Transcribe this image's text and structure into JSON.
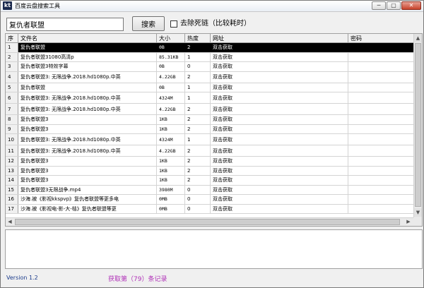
{
  "window": {
    "logo": "kt",
    "title": "百度云盘搜索工具",
    "controls": [
      "─",
      "▢",
      "✕"
    ]
  },
  "toolbar": {
    "search_value": "复仇者联盟",
    "search_button": "搜索",
    "dead_link_label": "去除死链（比较耗时）"
  },
  "table": {
    "columns": [
      "序",
      "文件名",
      "大小",
      "热度",
      "网址",
      "密码"
    ],
    "rows": [
      {
        "idx": "1",
        "name": "复仇者联盟",
        "size": "0B",
        "heat": "2",
        "url": "双击获取",
        "pwd": ""
      },
      {
        "idx": "2",
        "name": "复仇者联盟31080高清p",
        "size": "85.31KB",
        "heat": "1",
        "url": "双击获取",
        "pwd": ""
      },
      {
        "idx": "3",
        "name": "复仇者联盟3特效字幕",
        "size": "0B",
        "heat": "0",
        "url": "双击获取",
        "pwd": ""
      },
      {
        "idx": "4",
        "name": "复仇者联盟3: 无限战争.2018.hd1080p.中英",
        "size": "4.22GB",
        "heat": "2",
        "url": "双击获取",
        "pwd": ""
      },
      {
        "idx": "5",
        "name": "复仇者联盟",
        "size": "0B",
        "heat": "1",
        "url": "双击获取",
        "pwd": ""
      },
      {
        "idx": "6",
        "name": "复仇者联盟3: 无限战争.2018.hd1080p.中英",
        "size": "4324M",
        "heat": "1",
        "url": "双击获取",
        "pwd": ""
      },
      {
        "idx": "7",
        "name": "复仇者联盟3: 无限战争.2018.hd1080p.中英",
        "size": "4.22GB",
        "heat": "2",
        "url": "双击获取",
        "pwd": ""
      },
      {
        "idx": "8",
        "name": "复仇者联盟3",
        "size": "1KB",
        "heat": "2",
        "url": "双击获取",
        "pwd": ""
      },
      {
        "idx": "9",
        "name": "复仇者联盟3",
        "size": "1KB",
        "heat": "2",
        "url": "双击获取",
        "pwd": ""
      },
      {
        "idx": "10",
        "name": "复仇者联盟3: 无限战争.2018.hd1080p.中英",
        "size": "4324M",
        "heat": "1",
        "url": "双击获取",
        "pwd": ""
      },
      {
        "idx": "11",
        "name": "复仇者联盟3: 无限战争.2018.hd1080p.中英",
        "size": "4.22GB",
        "heat": "2",
        "url": "双击获取",
        "pwd": ""
      },
      {
        "idx": "12",
        "name": "复仇者联盟3",
        "size": "1KB",
        "heat": "2",
        "url": "双击获取",
        "pwd": ""
      },
      {
        "idx": "13",
        "name": "复仇者联盟3",
        "size": "1KB",
        "heat": "2",
        "url": "双击获取",
        "pwd": ""
      },
      {
        "idx": "14",
        "name": "复仇者联盟3",
        "size": "1KB",
        "heat": "2",
        "url": "双击获取",
        "pwd": ""
      },
      {
        "idx": "15",
        "name": "复仇者联盟3无限战争.mp4",
        "size": "3980M",
        "heat": "0",
        "url": "双击获取",
        "pwd": ""
      },
      {
        "idx": "16",
        "name": "沙海.被《影视kkspvp》复仇者联盟等更多电",
        "size": "0MB",
        "heat": "0",
        "url": "双击获取",
        "pwd": ""
      },
      {
        "idx": "17",
        "name": "沙海.被《影视电-影-大-桔》复仇者联盟等更",
        "size": "0MB",
        "heat": "0",
        "url": "双击获取",
        "pwd": ""
      }
    ]
  },
  "status": {
    "version": "Version 1.2",
    "count": "获取第（79）条记录"
  }
}
